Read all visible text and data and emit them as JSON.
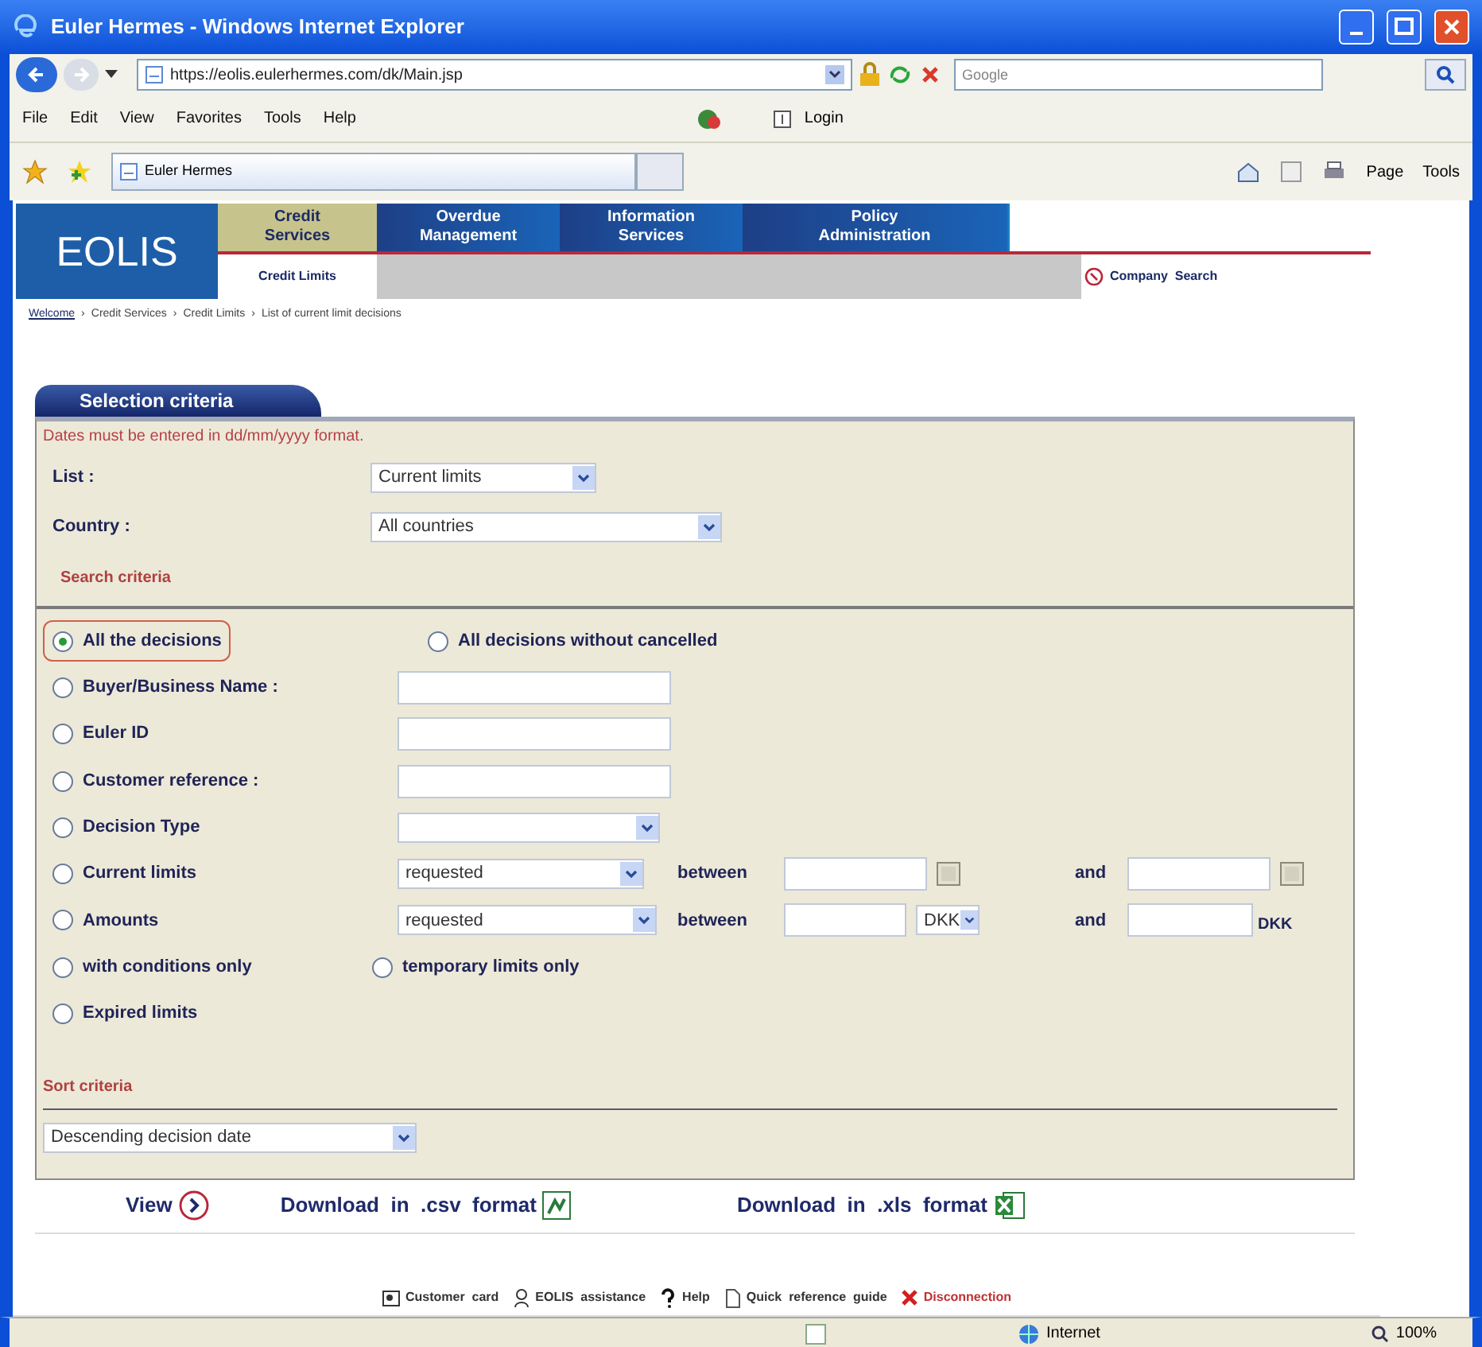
{
  "window": {
    "title": "Euler Hermes - Windows Internet Explorer"
  },
  "address_bar": {
    "url": "https://eolis.eulerhermes.com/dk/Main.jsp"
  },
  "search_box": {
    "placeholder": "Google"
  },
  "menu": [
    "File",
    "Edit",
    "View",
    "Favorites",
    "Tools",
    "Help"
  ],
  "toolbar": {
    "login": "Login"
  },
  "browser_tab": {
    "title": "Euler Hermes"
  },
  "command_bar": [
    "Page",
    "Tools"
  ],
  "site": {
    "logo": "EOLIS",
    "nav": [
      {
        "label": "Credit\nServices",
        "selected": true
      },
      {
        "label": "Overdue\nManagement",
        "selected": false
      },
      {
        "label": "Information\nServices",
        "selected": false
      },
      {
        "label": "Policy\nAdministration",
        "selected": false
      }
    ],
    "subnav": "Credit Limits",
    "company_search": "Company  Search",
    "breadcrumb": [
      {
        "label": "Welcome",
        "link": true
      },
      {
        "label": "Credit Services",
        "link": false
      },
      {
        "label": "Credit Limits",
        "link": false
      },
      {
        "label": "List of current limit decisions",
        "link": false
      }
    ],
    "separator": "›"
  },
  "form": {
    "tab": "Selection criteria",
    "note": "Dates must be entered in dd/mm/yyyy format.",
    "list": {
      "label": "List :",
      "value": "Current limits"
    },
    "country": {
      "label": "Country :",
      "value": "All countries"
    },
    "search_heading": "Search criteria",
    "rows": [
      {
        "kind": "pair",
        "radios": [
          {
            "label": "All the decisions",
            "selected": true,
            "highlighted": true
          },
          {
            "label": "All decisions without cancelled",
            "selected": false,
            "highlighted": false
          }
        ]
      },
      {
        "kind": "text",
        "radios": [
          {
            "label": "Buyer/Business Name :",
            "selected": false,
            "highlighted": false
          }
        ]
      },
      {
        "kind": "text",
        "radios": [
          {
            "label": "Euler ID",
            "selected": false,
            "highlighted": false
          }
        ]
      },
      {
        "kind": "text",
        "radios": [
          {
            "label": "Customer reference :",
            "selected": false,
            "highlighted": false
          }
        ]
      },
      {
        "kind": "select",
        "radios": [
          {
            "label": "Decision Type",
            "selected": false,
            "highlighted": false
          }
        ]
      },
      {
        "kind": "date_range",
        "radios": [
          {
            "label": "Current limits",
            "selected": false,
            "highlighted": false
          }
        ],
        "select": "requested",
        "between": "between",
        "and": "and"
      },
      {
        "kind": "amount_range",
        "radios": [
          {
            "label": "Amounts",
            "selected": false,
            "highlighted": false
          }
        ],
        "select": "requested",
        "between": "between",
        "currency": "DKK",
        "and": "and",
        "unit": "DKK"
      },
      {
        "kind": "pair_narrow",
        "radios": [
          {
            "label": "with conditions only",
            "selected": false,
            "highlighted": false
          },
          {
            "label": "temporary limits only",
            "selected": false,
            "highlighted": false
          }
        ]
      },
      {
        "kind": "plain",
        "radios": [
          {
            "label": "Expired limits",
            "selected": false,
            "highlighted": false
          }
        ]
      }
    ],
    "sort_heading": "Sort criteria",
    "sort": "Descending decision date"
  },
  "actions": {
    "view": "View",
    "csv": "Download  in  .csv  format",
    "xls": "Download  in  .xls  format"
  },
  "footer_links": [
    {
      "kind": "card",
      "label": "Customer  card"
    },
    {
      "kind": "person",
      "label": "EOLIS  assistance"
    },
    {
      "kind": "help",
      "label": "Help"
    },
    {
      "kind": "doc",
      "label": "Quick  reference  guide"
    },
    {
      "kind": "logout",
      "label": "Disconnection"
    }
  ],
  "status_bar": {
    "zone": "Internet",
    "zoom": "100%"
  }
}
